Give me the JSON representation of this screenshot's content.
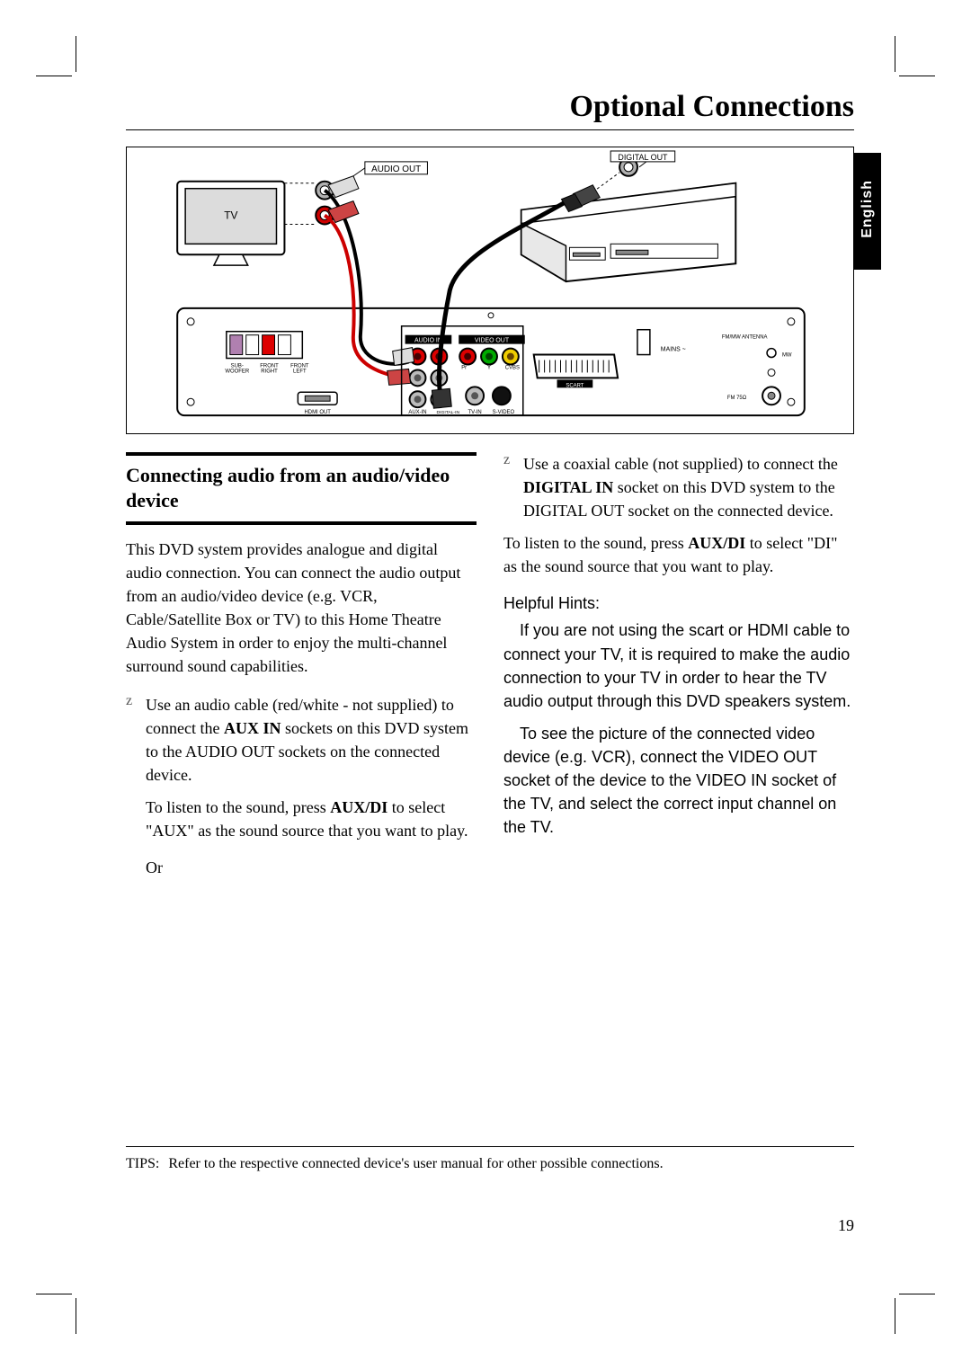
{
  "header": {
    "title": "Optional Connections"
  },
  "lang_tab": "English",
  "diagram": {
    "tv_label": "TV",
    "audio_out": "AUDIO OUT",
    "digital_out": "DIGITAL OUT",
    "rear": {
      "audio_in": "AUDIO IN",
      "video_out": "VIDEO OUT",
      "sub": "SUB-\nWOOFER",
      "front_rl": "FRONT\nRIGHT",
      "front_left": "FRONT\nLEFT",
      "hdmi_out": "HDMI OUT",
      "aux_in": "AUX-IN",
      "digital_in": "DIGITAL-IN",
      "tv_in": "TV-IN",
      "svideo": "S-VIDEO",
      "scart": "SCART",
      "pr": "Pr",
      "y": "Y",
      "cvbs": "CVBS",
      "fm_ant": "FM/MW ANTENNA",
      "mains": "MAINS ~",
      "fm": "FM 75Ω",
      "mw": "MW"
    }
  },
  "section": {
    "title": "Connecting audio from an audio/video device",
    "intro": "This DVD system provides analogue and digital audio connection. You can connect the audio output from an audio/video device (e.g. VCR, Cable/Satellite Box or TV) to this Home Theatre Audio System in order to enjoy the multi-channel surround sound capabilities.",
    "bullet1_a": "Use an audio cable (red/white - not supplied) to connect the ",
    "bullet1_bold": "AUX IN",
    "bullet1_b": " sockets on this DVD system to the AUDIO OUT sockets on the connected device.",
    "sub1_a": "To listen to the sound, press ",
    "sub1_bold": "AUX/DI",
    "sub1_b": " to select \"AUX\" as the sound source that you want to play.",
    "or": "Or",
    "bullet2_a": "Use a coaxial cable (not supplied) to connect the ",
    "bullet2_bold": "DIGITAL IN",
    "bullet2_b": " socket on this DVD system to the DIGITAL OUT socket on the connected device.",
    "sub2_a": "To listen to the sound, press ",
    "sub2_bold": "AUX/DI",
    "sub2_b": " to select \"DI\" as the sound source that you want to play.",
    "hints_title": "Helpful Hints:",
    "hints1": "If you are not using the scart or HDMI cable to connect your TV, it is required to make the audio connection to your TV in order to hear the TV audio output through this DVD speakers system.",
    "hints2": "To see the picture of the connected video device (e.g. VCR), connect the VIDEO OUT socket of the device to the VIDEO IN socket of the TV, and select the correct input channel on the TV."
  },
  "tips": {
    "label": "TIPS:",
    "text": "Refer to the respective connected device's user manual for other possible connections."
  },
  "page_number": "19",
  "bullet_marker": "z"
}
